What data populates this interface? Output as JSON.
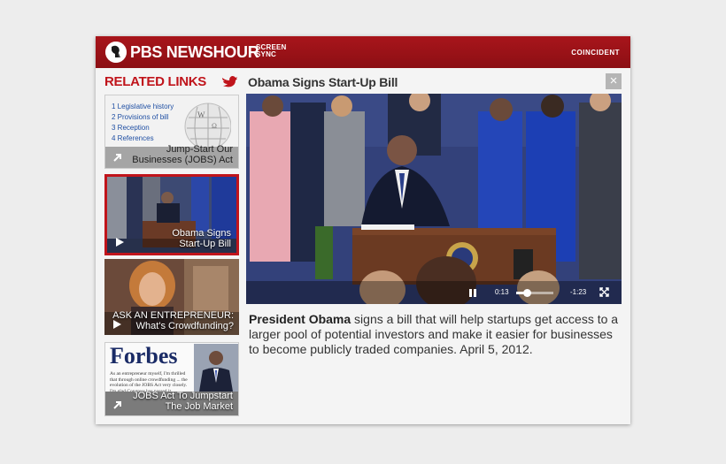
{
  "header": {
    "brand": "PBS NEWSHOUR",
    "brand_sub": "SCREEN SYNC",
    "partner": "COINCIDENT",
    "logo_icon": "pbs-head-icon"
  },
  "sidebar": {
    "title": "RELATED LINKS",
    "title_icon": "twitter-bird-icon",
    "cards": [
      {
        "list": [
          "1 Legislative history",
          "2 Provisions of bill",
          "3 Reception",
          "4 References"
        ],
        "caption_line1": "Jump-Start Our",
        "caption_line2": "Businesses (JOBS) Act",
        "icon": "arrow-link-icon"
      },
      {
        "caption_line1": "Obama Signs",
        "caption_line2": "Start-Up Bill",
        "icon": "play-icon",
        "selected": true
      },
      {
        "caption_line1": "ASK AN ENTREPRENEUR:",
        "caption_line2": "What's Crowdfunding?",
        "icon": "play-icon"
      },
      {
        "masthead": "Forbes",
        "article_excerpt": "As an entrepreneur myself, I'm thrilled that through online crowdfunding ... the evolution of the JOBS Act very closely. I'm glad Congress has passed it",
        "caption_line1": "JOBS Act To Jumpstart",
        "caption_line2": "The Job Market",
        "icon": "arrow-link-icon"
      }
    ]
  },
  "main": {
    "title": "Obama Signs Start-Up Bill",
    "close_label": "×",
    "video": {
      "elapsed": "0:13",
      "remaining": "-1:23",
      "progress": 0.3
    },
    "description_bold": "President Obama",
    "description_rest": " signs a bill that will help startups get access to a larger pool of potential investors and make it easier for businesses to become publicly traded companies. April 5, 2012."
  },
  "colors": {
    "brand_red": "#a8151b",
    "link_blue": "#1f4fa3",
    "selected_border": "#c0141b"
  }
}
